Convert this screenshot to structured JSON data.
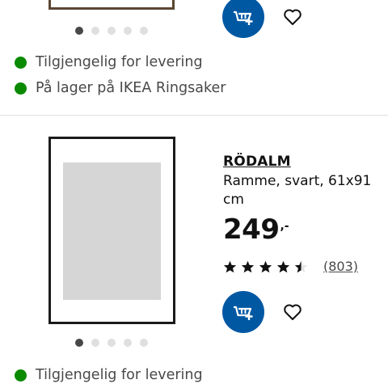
{
  "colors": {
    "accent": "#0058a3",
    "available": "#0a8a00"
  },
  "top_card": {
    "availability": [
      {
        "icon": "green-dot-icon",
        "text": "Tilgjengelig for levering"
      },
      {
        "icon": "green-dot-icon",
        "text": "På lager på IKEA Ringsaker"
      }
    ],
    "carousel": {
      "count": 5,
      "active": 1
    }
  },
  "product": {
    "name": "RÖDALM",
    "description": "Ramme, svart, 61x91 cm",
    "price": {
      "integer": "249",
      "decimals": ",-"
    },
    "rating": {
      "stars": 4.5,
      "max": 5,
      "review_count": "(803)"
    },
    "carousel": {
      "count": 5,
      "active": 1
    },
    "availability": [
      {
        "icon": "green-dot-icon",
        "text": "Tilgjengelig for levering"
      }
    ]
  }
}
